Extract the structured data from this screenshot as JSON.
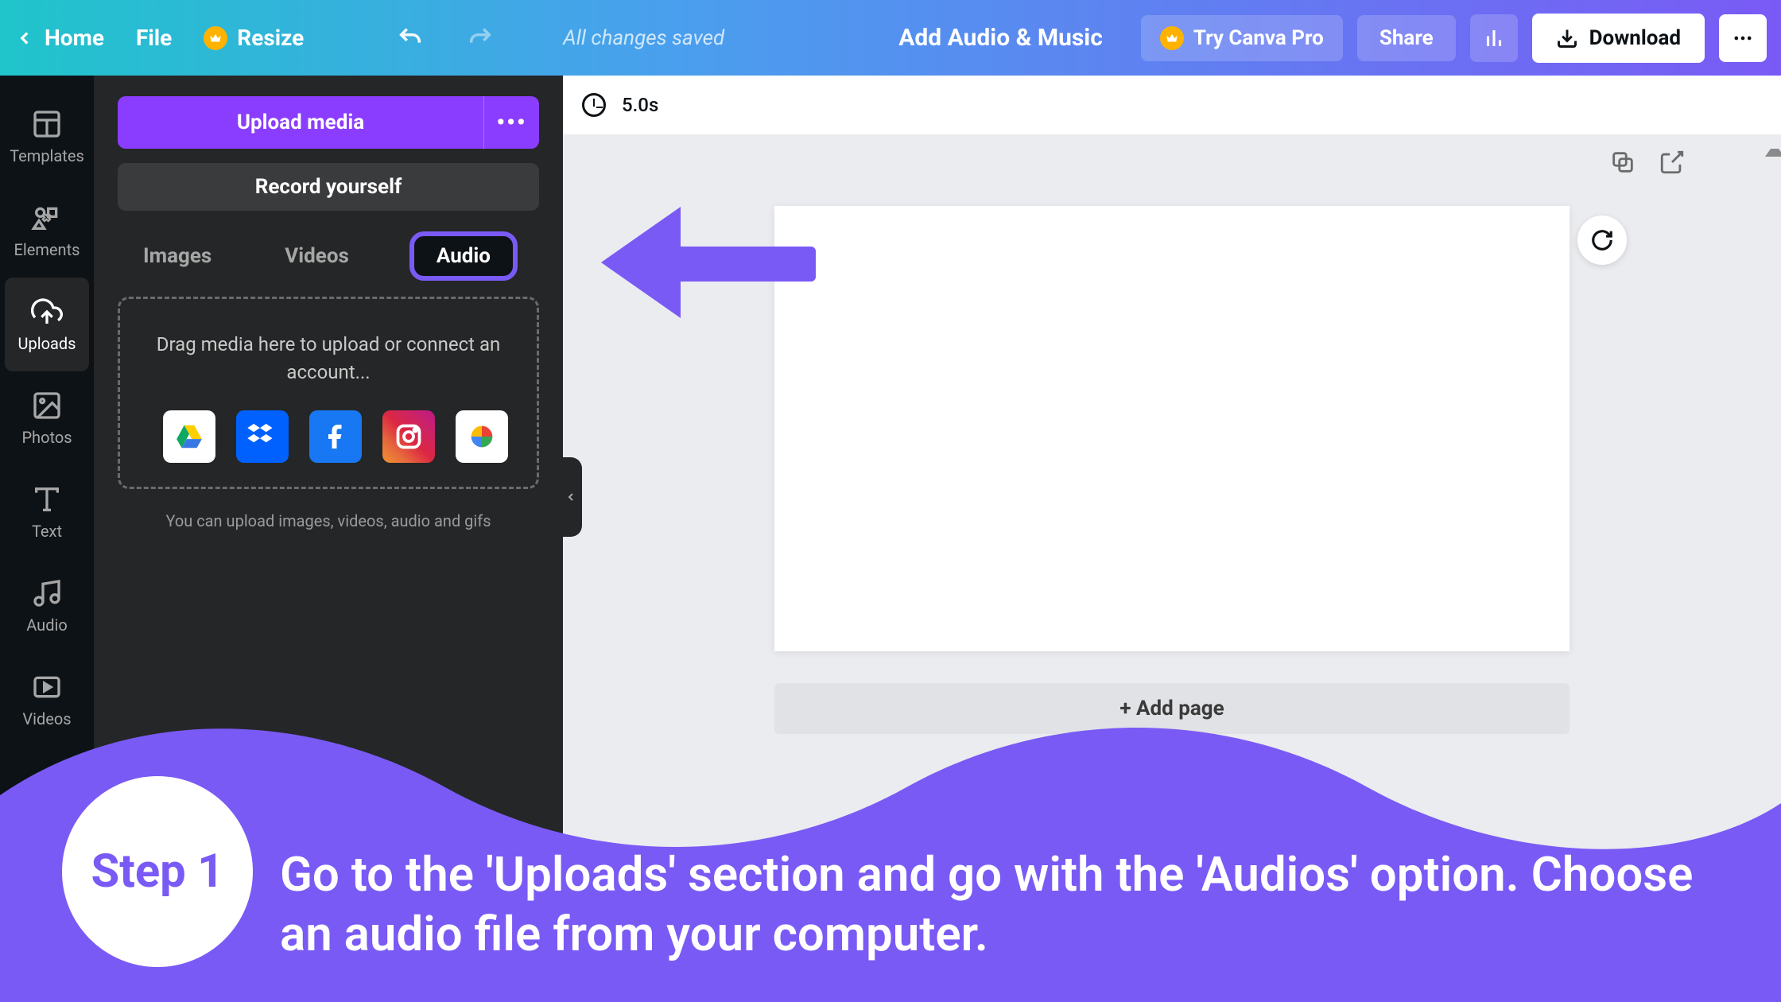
{
  "topbar": {
    "home": "Home",
    "file": "File",
    "resize": "Resize",
    "status": "All changes saved",
    "title": "Add Audio & Music",
    "try_pro": "Try Canva Pro",
    "share": "Share",
    "download": "Download"
  },
  "rail": {
    "templates": "Templates",
    "elements": "Elements",
    "uploads": "Uploads",
    "photos": "Photos",
    "text": "Text",
    "audio": "Audio",
    "videos": "Videos"
  },
  "panel": {
    "upload": "Upload media",
    "record": "Record yourself",
    "tab_images": "Images",
    "tab_videos": "Videos",
    "tab_audio": "Audio",
    "drop_line": "Drag media here to upload or connect an account...",
    "hint": "You can upload images, videos, audio and gifs"
  },
  "canvas": {
    "duration": "5.0s",
    "add_page": "+ Add page"
  },
  "annotation": {
    "step_label": "Step 1",
    "instruction": "Go to the 'Uploads' section and go with the 'Audios' option. Choose an audio file from your computer."
  }
}
